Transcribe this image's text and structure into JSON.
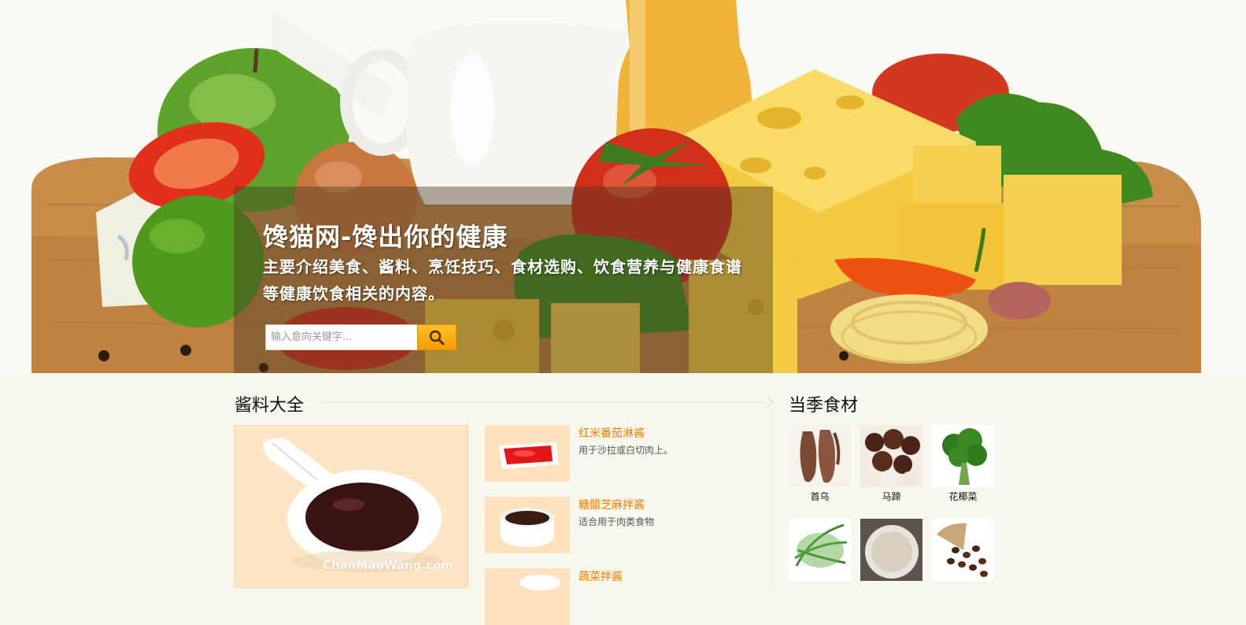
{
  "hero": {
    "title": "馋猫网-馋出你的健康",
    "description": "主要介绍美食、酱料、烹饪技巧、食材选购、饮食营养与健康食谱等健康饮食相关的内容。",
    "search": {
      "placeholder": "输入意向关键字...",
      "button_icon": "search-icon"
    }
  },
  "sauce_section": {
    "title": "酱料大全",
    "featured": {
      "watermark": "ChanMaoWang.com"
    },
    "items": [
      {
        "name": "红米番茄淋酱",
        "desc": "用于沙拉或白切肉上。"
      },
      {
        "name": "糖醋芝麻拌酱",
        "desc": "适合用于肉类食物"
      },
      {
        "name": "蔬菜拌酱",
        "desc": ""
      }
    ]
  },
  "season_section": {
    "title": "当季食材",
    "items": [
      {
        "name": "首乌"
      },
      {
        "name": "马蹄"
      },
      {
        "name": "花椰菜"
      },
      {
        "name": ""
      },
      {
        "name": ""
      },
      {
        "name": ""
      }
    ]
  }
}
